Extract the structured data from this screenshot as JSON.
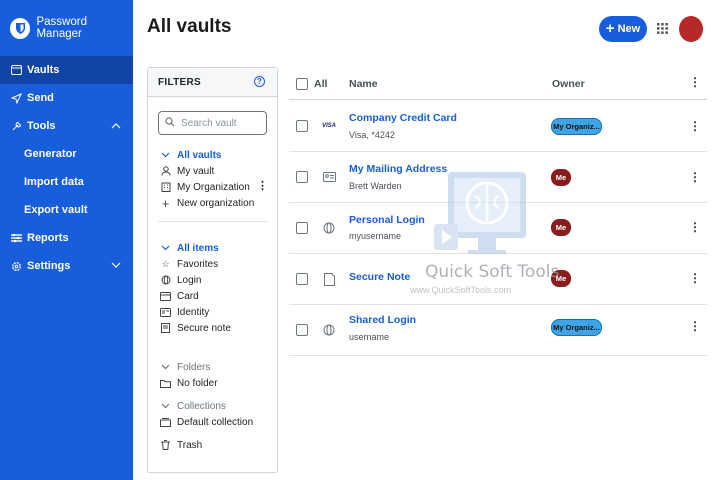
{
  "app": {
    "title": "Password Manager"
  },
  "sidebar": {
    "items": [
      {
        "label": "Vaults",
        "icon": "vault-icon",
        "active": true
      },
      {
        "label": "Send",
        "icon": "send-icon"
      },
      {
        "label": "Tools",
        "icon": "wrench-icon",
        "expanded": true
      },
      {
        "label": "Reports",
        "icon": "reports-icon"
      },
      {
        "label": "Settings",
        "icon": "gear-icon"
      }
    ],
    "tools_sub": [
      "Generator",
      "Import data",
      "Export vault"
    ]
  },
  "header": {
    "title": "All vaults",
    "new_label": "New"
  },
  "filters": {
    "title": "FILTERS",
    "search_placeholder": "Search vault",
    "vaults": [
      "All vaults",
      "My vault",
      "My Organization",
      "New organization"
    ],
    "types": [
      "All items",
      "Favorites",
      "Login",
      "Card",
      "Identity",
      "Secure note"
    ],
    "folders_label": "Folders",
    "folders": [
      "No folder"
    ],
    "collections_label": "Collections",
    "collections": [
      "Default collection"
    ],
    "trash": "Trash"
  },
  "table": {
    "col_all": "All",
    "col_name": "Name",
    "col_owner": "Owner",
    "rows": [
      {
        "name": "Company Credit Card",
        "sub": "Visa, *4242",
        "owner": "My Organiz...",
        "icon": "visa-card-icon"
      },
      {
        "name": "My Mailing Address",
        "sub": "Brett Warden",
        "owner": "Me",
        "icon": "identity-card-icon"
      },
      {
        "name": "Personal Login",
        "sub": "myusername",
        "owner": "Me",
        "icon": "globe-icon"
      },
      {
        "name": "Secure Note",
        "sub": "",
        "owner": "Me",
        "icon": "note-icon"
      },
      {
        "name": "Shared Login",
        "sub": "username",
        "owner": "My Organiz...",
        "icon": "globe-icon"
      }
    ]
  },
  "watermark": {
    "title": "Quick Soft Tools",
    "url": "www.QuickSoftTools.com"
  },
  "colors": {
    "brand": "#175ddc",
    "owner_me": "#8a1c1c",
    "owner_org": "#3ba5e8"
  }
}
